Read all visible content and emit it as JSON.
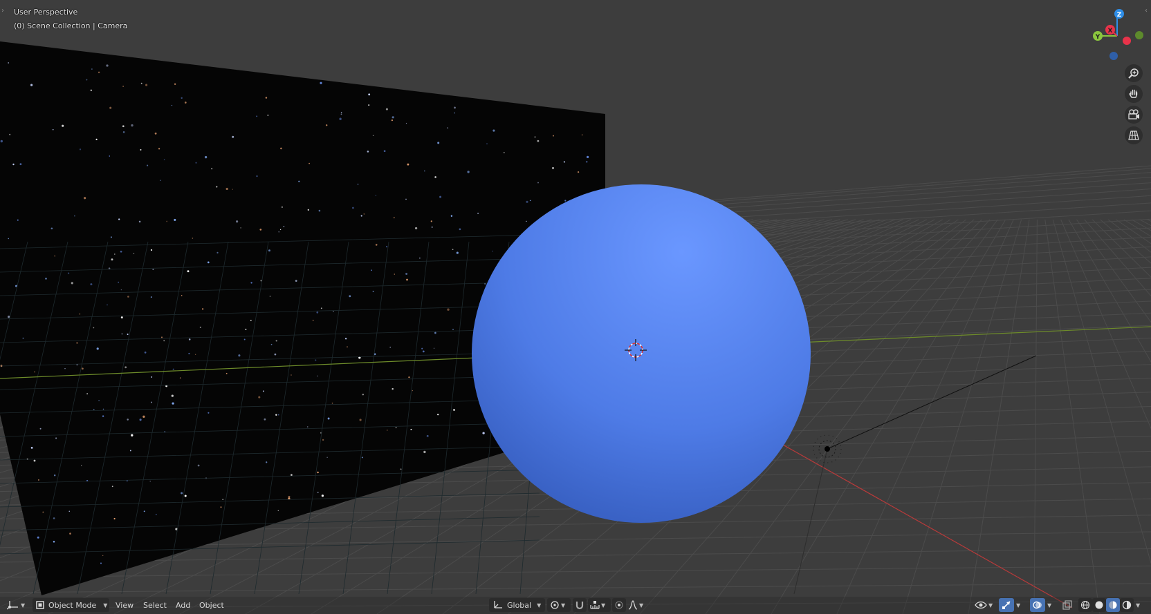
{
  "viewport": {
    "perspective_label": "User Perspective",
    "collection_label": "(0) Scene Collection | Camera"
  },
  "gizmo": {
    "x_label": "X",
    "y_label": "Y",
    "z_label": "Z",
    "x_color": "#e8334a",
    "y_color": "#8bc63e",
    "z_color": "#2e8ee8"
  },
  "nav_buttons": [
    "zoom-icon",
    "hand-pan-icon",
    "camera-view-icon",
    "grid-ortho-icon"
  ],
  "header": {
    "mode_label": "Object Mode",
    "menus": [
      "View",
      "Select",
      "Add",
      "Object"
    ],
    "orientation_label": "Global"
  },
  "scene": {
    "sphere_color": "#5b86f0",
    "backdrop_color": "#050505",
    "grid_color": "#4c4c4c",
    "x_axis_color": "#b83a3a",
    "y_axis_color": "#6e8c2a"
  }
}
